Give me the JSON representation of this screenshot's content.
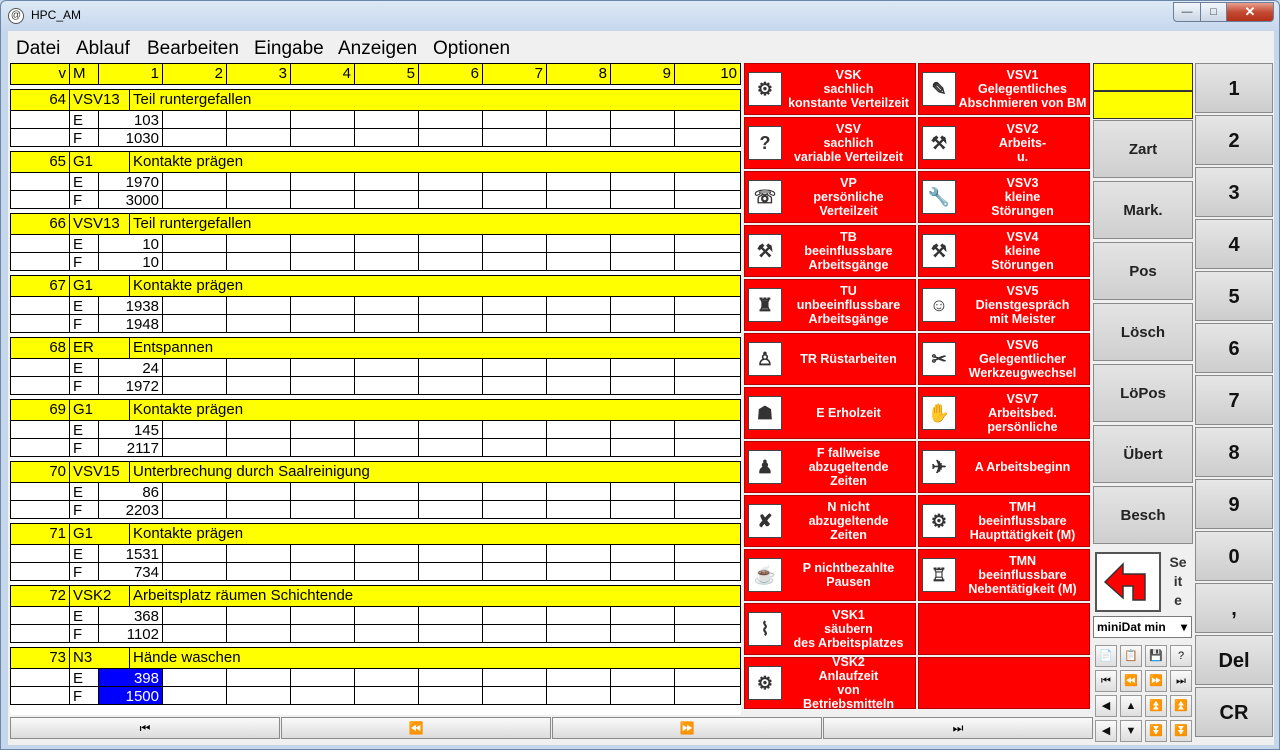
{
  "window": {
    "title": "HPC_AM",
    "min": "—",
    "max": "□",
    "close": "✕"
  },
  "menu": [
    "Datei",
    "Ablauf",
    "Bearbeiten",
    "Eingabe",
    "Anzeigen",
    "Optionen"
  ],
  "header": [
    "v",
    "M",
    "1",
    "2",
    "3",
    "4",
    "5",
    "6",
    "7",
    "8",
    "9",
    "10"
  ],
  "rows": [
    {
      "v": "64",
      "m": "VSV13",
      "desc": "Teil runtergefallen",
      "e": "103",
      "f": "1030"
    },
    {
      "v": "65",
      "m": "G1",
      "desc": "Kontakte prägen",
      "e": "1970",
      "f": "3000"
    },
    {
      "v": "66",
      "m": "VSV13",
      "desc": "Teil runtergefallen",
      "e": "10",
      "f": "10"
    },
    {
      "v": "67",
      "m": "G1",
      "desc": "Kontakte prägen",
      "e": "1938",
      "f": "1948"
    },
    {
      "v": "68",
      "m": "ER",
      "desc": "Entspannen",
      "e": "24",
      "f": "1972"
    },
    {
      "v": "69",
      "m": "G1",
      "desc": "Kontakte prägen",
      "e": "145",
      "f": "2117"
    },
    {
      "v": "70",
      "m": "VSV15",
      "desc": "Unterbrechung durch Saalreinigung",
      "e": "86",
      "f": "2203"
    },
    {
      "v": "71",
      "m": "G1",
      "desc": "Kontakte prägen",
      "e": "1531",
      "f": "734"
    },
    {
      "v": "72",
      "m": "VSK2",
      "desc": "Arbeitsplatz räumen Schichtende",
      "e": "368",
      "f": "1102"
    },
    {
      "v": "73",
      "m": "N3",
      "desc": "Hände waschen",
      "e": "398",
      "f": "1500"
    }
  ],
  "row_labels": {
    "e": "E",
    "f": "F"
  },
  "nav": [
    "⏮",
    "⏪",
    "⏩",
    "⏭"
  ],
  "left_buttons": [
    {
      "icon": "vacuum-icon",
      "glyph": "⚙",
      "label": "VSK\nsachlich\nkonstante Verteilzeit"
    },
    {
      "icon": "question-icon",
      "glyph": "?",
      "label": "VSV\nsachlich\nvariable Verteilzeit"
    },
    {
      "icon": "phone-icon",
      "glyph": "☏",
      "label": "VP\npersönliche\nVerteilzeit"
    },
    {
      "icon": "machine-icon",
      "glyph": "⚒",
      "label": "TB\nbeeinflussbare\nArbeitsgänge"
    },
    {
      "icon": "chair-icon",
      "glyph": "♜",
      "label": "TU\nunbeeinflussbare\nArbeitsgänge"
    },
    {
      "icon": "worker-icon",
      "glyph": "♙",
      "label": "TR Rüstarbeiten"
    },
    {
      "icon": "helmet-icon",
      "glyph": "☗",
      "label": "E Erholzeit"
    },
    {
      "icon": "soldier-icon",
      "glyph": "♟",
      "label": "F fallweise\nabzugeltende\nZeiten"
    },
    {
      "icon": "fall-icon",
      "glyph": "✘",
      "label": "N nicht\nabzugeltende\nZeiten"
    },
    {
      "icon": "break-icon",
      "glyph": "☕",
      "label": "P nichtbezahlte\nPausen"
    },
    {
      "icon": "broom-icon",
      "glyph": "⌇",
      "label": "VSK1\nsäubern\ndes Arbeitsplatzes"
    },
    {
      "icon": "gear-icon",
      "glyph": "⚙",
      "label": "VSK2\nAnlaufzeit\nvon\nBetriebsmitteln"
    }
  ],
  "right_buttons": [
    {
      "icon": "oilcan-icon",
      "glyph": "✎",
      "label": "VSV1\nGelegentliches\nAbschmieren von BM"
    },
    {
      "icon": "repair-icon",
      "glyph": "⚒",
      "label": "VSV2\nArbeits-\nu."
    },
    {
      "icon": "wrench-icon",
      "glyph": "🔧",
      "label": "VSV3\nkleine\nStörungen"
    },
    {
      "icon": "hammer-icon",
      "glyph": "⚒",
      "label": "VSV4\nkleine\nStörungen"
    },
    {
      "icon": "meeting-icon",
      "glyph": "☺",
      "label": "VSV5\nDienstgespräch\nmit Meister"
    },
    {
      "icon": "tools-icon",
      "glyph": "✂",
      "label": "VSV6\nGelegentlicher\nWerkzeugwechsel"
    },
    {
      "icon": "glove-icon",
      "glyph": "✋",
      "label": "VSV7\nArbeitsbed.\npersönliche"
    },
    {
      "icon": "start-icon",
      "glyph": "✈",
      "label": "A Arbeitsbeginn"
    },
    {
      "icon": "drill-icon",
      "glyph": "⚙",
      "label": "TMH\nbeeinflussbare\nHaupttätigkeit (M)"
    },
    {
      "icon": "robot-icon",
      "glyph": "♖",
      "label": "TMN\nbeeinflussbare\nNebentätigkeit (M)"
    },
    {
      "icon": "",
      "glyph": "",
      "label": ""
    },
    {
      "icon": "",
      "glyph": "",
      "label": ""
    }
  ],
  "side": {
    "buttons": [
      "Zart",
      "Mark.",
      "Pos",
      "Lösch",
      "LöPos",
      "Übert",
      "Besch"
    ],
    "seite": "Se\nit\ne",
    "dropdown": "miniDat min",
    "dropdown_arrow": "▾"
  },
  "numpad": [
    "1",
    "2",
    "3",
    "4",
    "5",
    "6",
    "7",
    "8",
    "9",
    "0",
    ",",
    "Del",
    "CR"
  ],
  "small_buttons": [
    "📄",
    "📋",
    "💾",
    "?",
    "⏮",
    "⏪",
    "⏩",
    "⏭",
    "◀",
    "▲",
    "⏫",
    "⏫",
    "◀",
    "▼",
    "⏬",
    "⏬"
  ]
}
